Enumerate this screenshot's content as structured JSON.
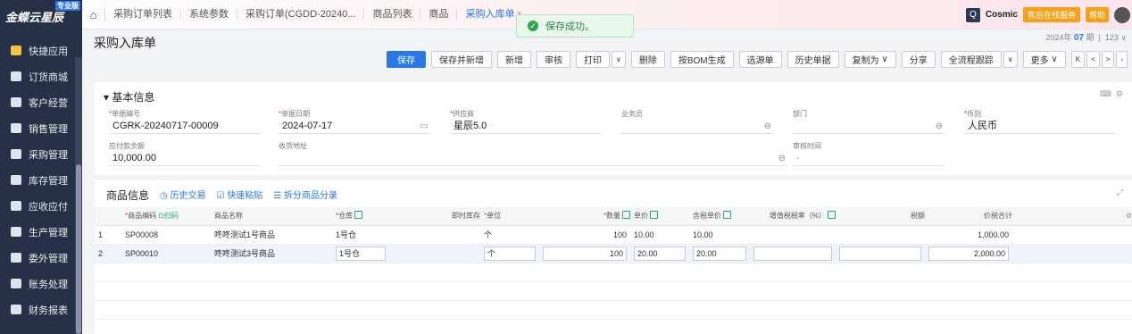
{
  "brand": {
    "name": "金蝶云星辰",
    "badge": "专业版"
  },
  "sidebar": {
    "items": [
      {
        "label": "快捷应用",
        "icon": "apps-icon"
      },
      {
        "label": "订货商城",
        "icon": "shop-icon"
      },
      {
        "label": "客户经营",
        "icon": "customer-icon"
      },
      {
        "label": "销售管理",
        "icon": "sales-icon"
      },
      {
        "label": "采购管理",
        "icon": "purchase-icon"
      },
      {
        "label": "库存管理",
        "icon": "inventory-icon"
      },
      {
        "label": "应收应付",
        "icon": "finance-icon"
      },
      {
        "label": "生产管理",
        "icon": "production-icon"
      },
      {
        "label": "委外管理",
        "icon": "outsource-icon"
      },
      {
        "label": "账务处理",
        "icon": "ledger-icon"
      },
      {
        "label": "财务报表",
        "icon": "report-icon"
      }
    ]
  },
  "tabs": [
    {
      "label": "采购订单列表"
    },
    {
      "label": "系统参数"
    },
    {
      "label": "采购订单(CGDD-20240..."
    },
    {
      "label": "商品列表"
    },
    {
      "label": "商品"
    },
    {
      "label": "采购入库单",
      "active": true,
      "close": "×"
    }
  ],
  "toast": {
    "text": "保存成功。",
    "check": "✓"
  },
  "topright": {
    "search": "Q",
    "cosmic": "Cosmic",
    "service": "售后在线服务",
    "help": "帮助"
  },
  "page": {
    "title": "采购入库单",
    "date_prefix": "2024年",
    "date_month": "07",
    "date_suffix": "期",
    "count": "123 ∨"
  },
  "toolbar": {
    "save": "保存",
    "save_new": "保存并新增",
    "new": "新增",
    "audit": "审核",
    "print": "打印",
    "delete": "删除",
    "bom": "按BOM生成",
    "select_src": "选源单",
    "history": "历史单据",
    "copy": "复制为",
    "share": "分享",
    "track": "全流程跟踪",
    "more": "更多",
    "first": "K",
    "prev": "<",
    "next": ">",
    "last": "›",
    "caret": "∨"
  },
  "basic": {
    "section": "基本信息",
    "fields": {
      "bill_no": {
        "label": "单据编号",
        "value": "CGRK-20240717-00009"
      },
      "bill_date": {
        "label": "单据日期",
        "value": "2024-07-17"
      },
      "supplier": {
        "label": "供应商",
        "value": "星辰5.0"
      },
      "salesman": {
        "label": "业务员",
        "value": ""
      },
      "dept": {
        "label": "部门",
        "value": ""
      },
      "currency": {
        "label": "币别",
        "value": "人民币"
      },
      "payable": {
        "label": "应付款余额",
        "value": "10,000.00"
      },
      "address": {
        "label": "收货地址",
        "value": ""
      },
      "audit_time": {
        "label": "审核时间",
        "value": "-"
      }
    }
  },
  "goods": {
    "section": "商品信息",
    "history": "历史交易",
    "paste": "快速粘贴",
    "split": "拆分商品分录",
    "columns": {
      "code": "商品编码",
      "scan": "扫码",
      "name": "商品名称",
      "warehouse": "仓库",
      "stock": "即时库存",
      "unit": "单位",
      "qty": "数量",
      "price": "单价",
      "taxprice": "含税单价",
      "vat": "增值税税率（%）",
      "tax": "税额",
      "total": "价税合计"
    },
    "rows": [
      {
        "no": "1",
        "code": "SP00008",
        "name": "咚咚测试1号商品",
        "warehouse": "1号仓",
        "stock": "",
        "unit": "个",
        "qty": "100",
        "price": "10.00",
        "taxprice": "10.00",
        "vat": "",
        "tax": "",
        "total": "1,000.00"
      },
      {
        "no": "2",
        "code": "SP00010",
        "name": "咚咚测试3号商品",
        "warehouse": "1号仓",
        "stock": "",
        "unit": "个",
        "qty": "100",
        "price": "20.00",
        "taxprice": "20.00",
        "vat": "",
        "tax": "",
        "total": "2,000.00"
      }
    ]
  }
}
